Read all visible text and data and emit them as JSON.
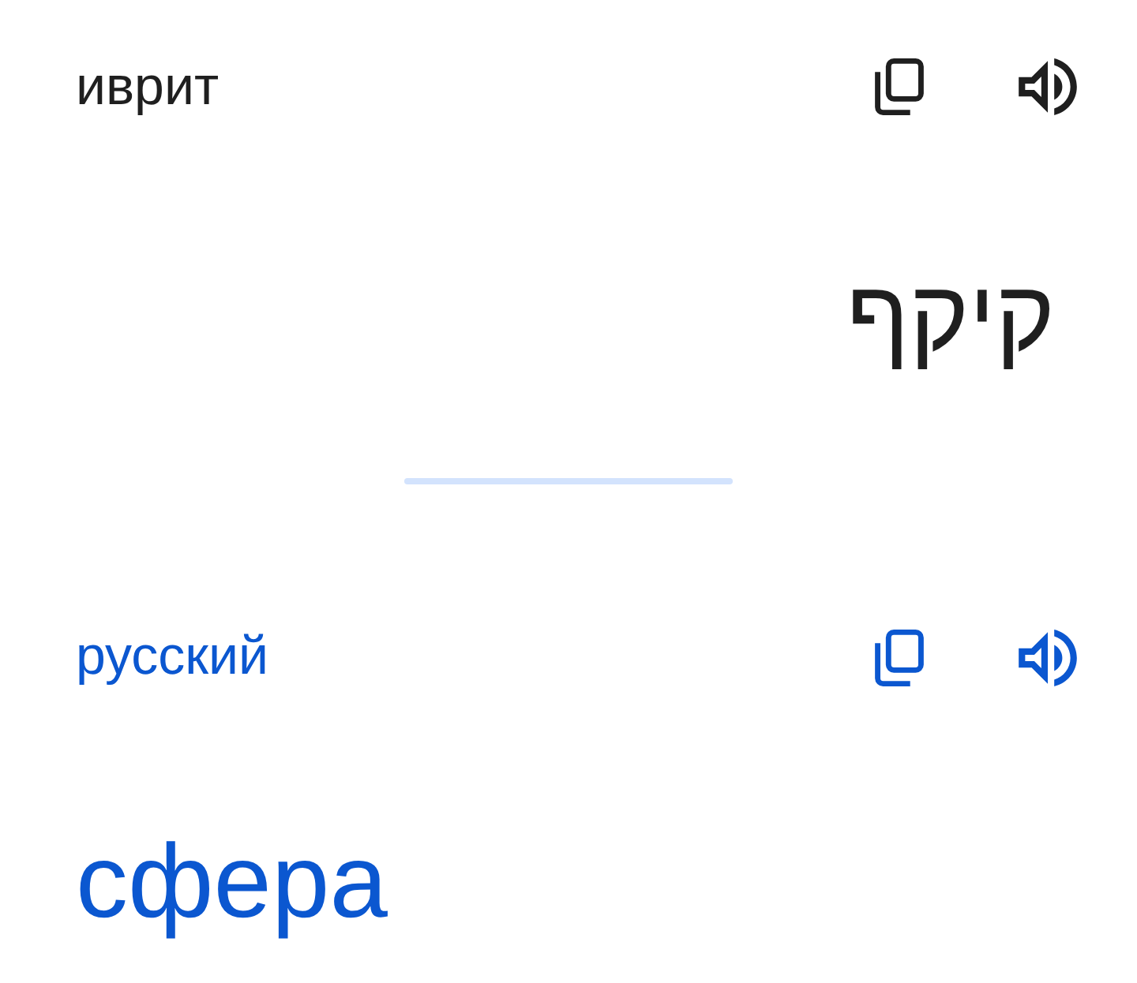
{
  "panels": [
    {
      "kind": "source",
      "language": "иврит",
      "text": "קיקף"
    },
    {
      "kind": "target",
      "language": "русский",
      "text": "сфера"
    }
  ]
}
